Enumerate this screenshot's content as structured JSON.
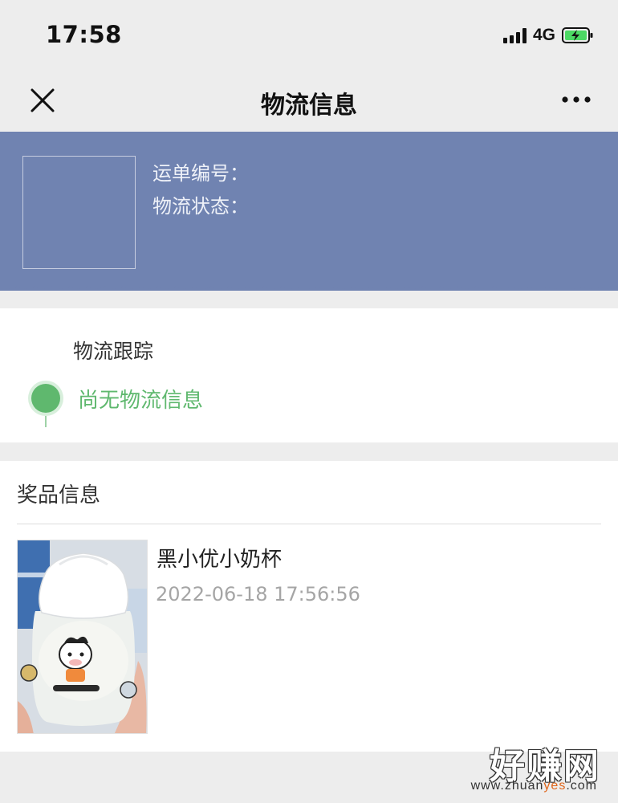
{
  "status_bar": {
    "time": "17:58",
    "network": "4G",
    "icons": [
      "cellular-signal-icon",
      "battery-charging-icon"
    ]
  },
  "nav": {
    "title": "物流信息",
    "icons": [
      "close-icon",
      "more-icon"
    ]
  },
  "header": {
    "tracking_number_label": "运单编号：",
    "status_label": "物流状态："
  },
  "tracking": {
    "title": "物流跟踪",
    "empty_text": "尚无物流信息",
    "accent_color": "#5fb86e"
  },
  "prize": {
    "title": "奖品信息",
    "item": {
      "name": "黑小优小奶杯",
      "date": "2022-06-18 17:56:56",
      "image": "milk-cup-photo"
    }
  },
  "watermark": {
    "main": "好赚网",
    "url_prefix": "www.zhuan",
    "url_highlight": "yes",
    "url_suffix": ".com"
  },
  "colors": {
    "banner": "#7083b1",
    "page_bg": "#ededed",
    "date_gray": "#a5a5a5"
  }
}
